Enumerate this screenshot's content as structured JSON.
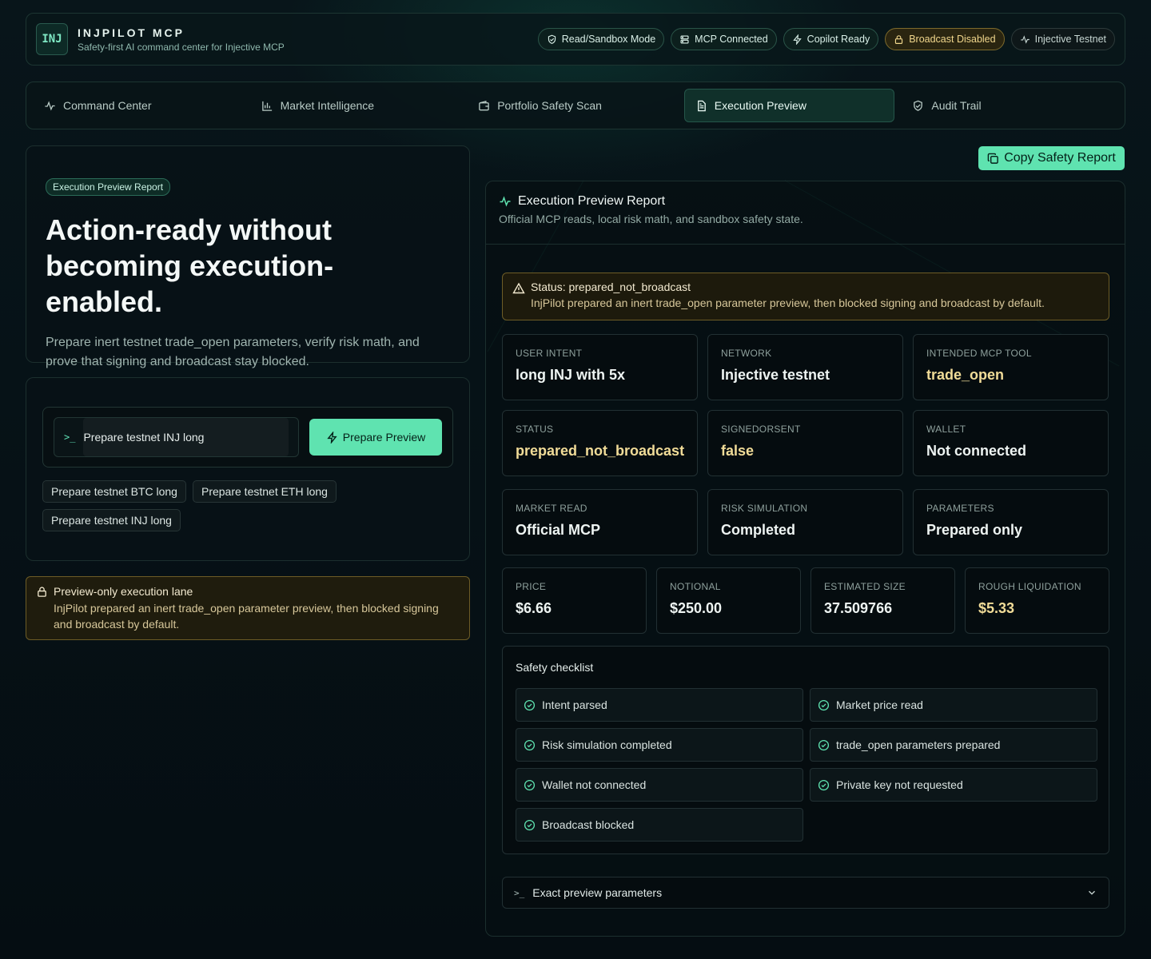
{
  "header": {
    "logo": "INJ",
    "title": "INJPILOT MCP",
    "subtitle": "Safety-first AI command center for Injective MCP",
    "badges": [
      "Read/Sandbox Mode",
      "MCP Connected",
      "Copilot Ready",
      "Broadcast Disabled",
      "Injective Testnet"
    ]
  },
  "tabs": [
    {
      "label": "Command Center",
      "icon": "activity-icon",
      "active": false
    },
    {
      "label": "Market Intelligence",
      "icon": "bar-chart-icon",
      "active": false
    },
    {
      "label": "Portfolio Safety Scan",
      "icon": "wallet-icon",
      "active": false
    },
    {
      "label": "Execution Preview",
      "icon": "document-icon",
      "active": true
    },
    {
      "label": "Audit Trail",
      "icon": "shield-icon",
      "active": false
    }
  ],
  "hero": {
    "pill": "Execution Preview Report",
    "title": "Action-ready without becoming execution-enabled.",
    "text": "Prepare inert testnet trade_open parameters, verify risk math, and prove that signing and broadcast stay blocked."
  },
  "prompt": {
    "value": "Prepare testnet INJ long",
    "button": "Prepare Preview",
    "suggestions": [
      "Prepare testnet BTC long",
      "Prepare testnet ETH long",
      "Prepare testnet INJ long"
    ]
  },
  "lane_note": {
    "title": "Preview-only execution lane",
    "text": "InjPilot prepared an inert trade_open parameter preview, then blocked signing and broadcast by default."
  },
  "report": {
    "copy_button": "Copy Safety Report",
    "title": "Execution Preview Report",
    "subtitle": "Official MCP reads, local risk math, and sandbox safety state.",
    "status_line": "Status: prepared_not_broadcast",
    "status_text": "InjPilot prepared an inert trade_open parameter preview, then blocked signing and broadcast by default.",
    "stats": [
      {
        "label": "USER INTENT",
        "value": "long INJ with 5x"
      },
      {
        "label": "NETWORK",
        "value": "Injective testnet"
      },
      {
        "label": "INTENDED MCP TOOL",
        "value": "trade_open"
      },
      {
        "label": "STATUS",
        "value": "prepared_not_broadcast"
      },
      {
        "label": "SIGNEDORSENT",
        "value": "false"
      },
      {
        "label": "WALLET",
        "value": "Not connected"
      },
      {
        "label": "MARKET READ",
        "value": "Official MCP"
      },
      {
        "label": "RISK SIMULATION",
        "value": "Completed"
      },
      {
        "label": "PARAMETERS",
        "value": "Prepared only"
      }
    ],
    "metrics": [
      {
        "label": "PRICE",
        "value": "$6.66"
      },
      {
        "label": "NOTIONAL",
        "value": "$250.00"
      },
      {
        "label": "ESTIMATED SIZE",
        "value": "37.509766"
      },
      {
        "label": "ROUGH LIQUIDATION",
        "value": "$5.33"
      }
    ],
    "checklist_title": "Safety checklist",
    "checklist": [
      "Intent parsed",
      "Market price read",
      "Risk simulation completed",
      "trade_open parameters prepared",
      "Wallet not connected",
      "Private key not requested",
      "Broadcast blocked"
    ],
    "accordion": "Exact preview parameters"
  },
  "colors": {
    "accent": "#5fe3b0",
    "warning": "#f1dc98",
    "background": "#061217"
  }
}
